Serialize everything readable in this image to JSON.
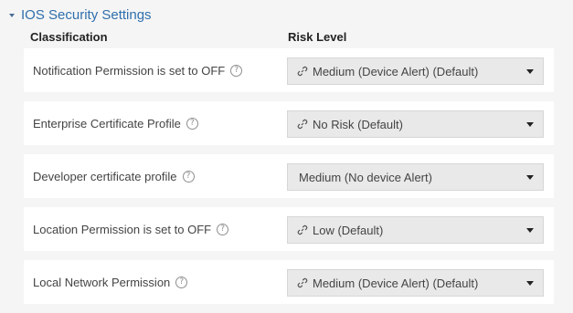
{
  "section": {
    "title": "IOS Security Settings"
  },
  "columns": {
    "classification": "Classification",
    "risk_level": "Risk Level"
  },
  "rows": [
    {
      "label": "Notification Permission is set to OFF",
      "risk": "Medium (Device Alert) (Default)",
      "linked": true
    },
    {
      "label": "Enterprise Certificate Profile",
      "risk": "No Risk (Default)",
      "linked": true
    },
    {
      "label": "Developer certificate profile",
      "risk": "Medium (No device Alert)",
      "linked": false
    },
    {
      "label": "Location Permission is set to OFF",
      "risk": "Low (Default)",
      "linked": true
    },
    {
      "label": "Local Network Permission",
      "risk": "Medium (Device Alert) (Default)",
      "linked": true
    }
  ],
  "icons": {
    "help": "question-circle-icon",
    "link": "link-icon",
    "dropdown": "caret-down-icon",
    "section_toggle": "caret-down-icon"
  },
  "colors": {
    "section_title": "#2f6fad",
    "background": "#f5f5f5",
    "row_background": "#ffffff",
    "select_background": "#e9e9e9"
  }
}
